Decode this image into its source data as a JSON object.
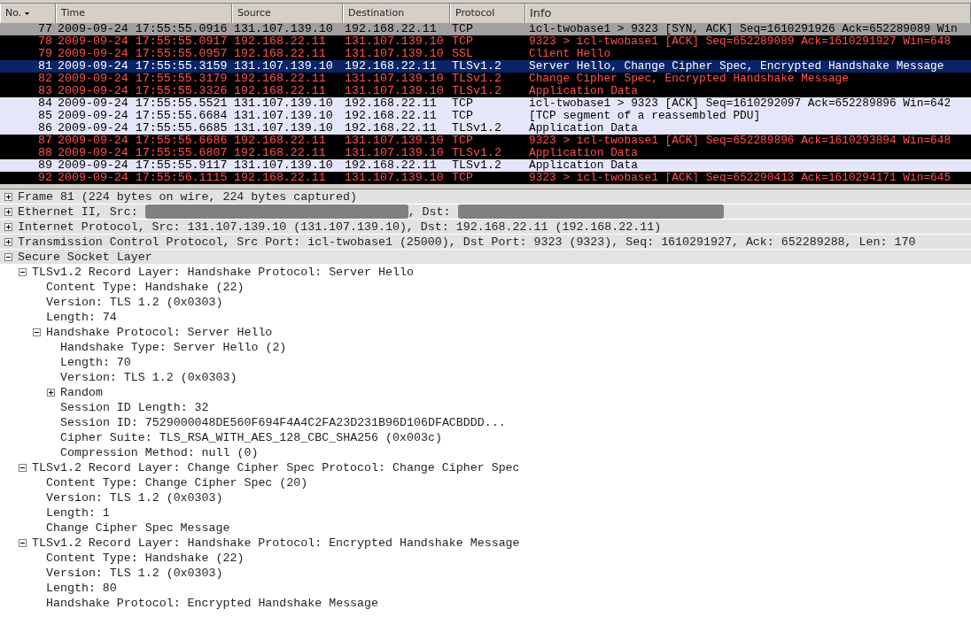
{
  "packet_list": {
    "columns": [
      {
        "label": "No.",
        "sorted": true
      },
      {
        "label": "Time",
        "sorted": false
      },
      {
        "label": "Source",
        "sorted": false
      },
      {
        "label": "Destination",
        "sorted": false
      },
      {
        "label": "Protocol",
        "sorted": false
      },
      {
        "label": "Info",
        "sorted": false
      }
    ],
    "rows": [
      {
        "no": "77",
        "time": "2009-09-24 17:55:55.0916",
        "source": "131.107.139.10",
        "destination": "192.168.22.11",
        "protocol": "TCP",
        "info": "icl-twobase1 > 9323 [SYN, ACK] Seq=1610291926 Ack=652289089 Win",
        "kind": "muted",
        "selected": false
      },
      {
        "no": "78",
        "time": "2009-09-24 17:55:55.0917",
        "source": "192.168.22.11",
        "destination": "131.107.139.10",
        "protocol": "TCP",
        "info": "9323 > icl-twobase1 [ACK] Seq=652289089 Ack=1610291927 Win=648",
        "kind": "alert",
        "selected": false
      },
      {
        "no": "79",
        "time": "2009-09-24 17:55:55.0957",
        "source": "192.168.22.11",
        "destination": "131.107.139.10",
        "protocol": "SSL",
        "info": "Client Hello",
        "kind": "alert",
        "selected": false
      },
      {
        "no": "81",
        "time": "2009-09-24 17:55:55.3159",
        "source": "131.107.139.10",
        "destination": "192.168.22.11",
        "protocol": "TLSv1.2",
        "info": "Server Hello, Change Cipher Spec, Encrypted Handshake Message",
        "kind": "normal",
        "selected": true
      },
      {
        "no": "82",
        "time": "2009-09-24 17:55:55.3179",
        "source": "192.168.22.11",
        "destination": "131.107.139.10",
        "protocol": "TLSv1.2",
        "info": "Change Cipher Spec, Encrypted Handshake Message",
        "kind": "alert",
        "selected": false
      },
      {
        "no": "83",
        "time": "2009-09-24 17:55:55.3326",
        "source": "192.168.22.11",
        "destination": "131.107.139.10",
        "protocol": "TLSv1.2",
        "info": "Application Data",
        "kind": "alert",
        "selected": false
      },
      {
        "no": "84",
        "time": "2009-09-24 17:55:55.5521",
        "source": "131.107.139.10",
        "destination": "192.168.22.11",
        "protocol": "TCP",
        "info": "icl-twobase1 > 9323 [ACK] Seq=1610292097 Ack=652289896 Win=642",
        "kind": "normal",
        "selected": false
      },
      {
        "no": "85",
        "time": "2009-09-24 17:55:55.6684",
        "source": "131.107.139.10",
        "destination": "192.168.22.11",
        "protocol": "TCP",
        "info": "[TCP segment of a reassembled PDU]",
        "kind": "normal",
        "selected": false
      },
      {
        "no": "86",
        "time": "2009-09-24 17:55:55.6685",
        "source": "131.107.139.10",
        "destination": "192.168.22.11",
        "protocol": "TLSv1.2",
        "info": "Application Data",
        "kind": "normal",
        "selected": false
      },
      {
        "no": "87",
        "time": "2009-09-24 17:55:55.6686",
        "source": "192.168.22.11",
        "destination": "131.107.139.10",
        "protocol": "TCP",
        "info": "9323 > icl-twobase1 [ACK] Seq=652289896 Ack=1610293894 Win=648",
        "kind": "alert",
        "selected": false
      },
      {
        "no": "88",
        "time": "2009-09-24 17:55:55.6807",
        "source": "192.168.22.11",
        "destination": "131.107.139.10",
        "protocol": "TLSv1.2",
        "info": "Application Data",
        "kind": "alert",
        "selected": false
      },
      {
        "no": "89",
        "time": "2009-09-24 17:55:55.9117",
        "source": "131.107.139.10",
        "destination": "192.168.22.11",
        "protocol": "TLSv1.2",
        "info": "Application Data",
        "kind": "normal",
        "selected": false
      },
      {
        "no": "92",
        "time": "2009-09-24 17:55:56.1115",
        "source": "192.168.22.11",
        "destination": "131.107.139.10",
        "protocol": "TCP",
        "info": "9323 > icl-twobase1 [ACK] Seq=652290413 Ack=1610294171 Win=645",
        "kind": "alert",
        "selected": false
      }
    ]
  },
  "packet_details": [
    {
      "label": "Frame 81 (224 bytes on wire, 224 bytes captured)",
      "expanded": false
    },
    {
      "parts": [
        {
          "kind": "text",
          "text": "Ethernet II, Src: "
        },
        {
          "kind": "redacted"
        },
        {
          "kind": "text",
          "text": ", Dst: "
        },
        {
          "kind": "redacted"
        }
      ],
      "expanded": false
    },
    {
      "label": "Internet Protocol, Src: 131.107.139.10 (131.107.139.10), Dst: 192.168.22.11 (192.168.22.11)",
      "expanded": false
    },
    {
      "label": "Transmission Control Protocol, Src Port: icl-twobase1 (25000), Dst Port: 9323 (9323), Seq: 1610291927, Ack: 652289288, Len: 170",
      "expanded": false
    },
    {
      "label": "Secure Socket Layer",
      "expanded": true,
      "children": [
        {
          "label": "TLSv1.2 Record Layer: Handshake Protocol: Server Hello",
          "expanded": true,
          "children": [
            {
              "label": "Content Type: Handshake (22)"
            },
            {
              "label": "Version: TLS 1.2 (0x0303)"
            },
            {
              "label": "Length: 74"
            },
            {
              "label": "Handshake Protocol: Server Hello",
              "expanded": true,
              "children": [
                {
                  "label": "Handshake Type: Server Hello (2)"
                },
                {
                  "label": "Length: 70"
                },
                {
                  "label": "Version: TLS 1.2 (0x0303)"
                },
                {
                  "label": "Random",
                  "expanded": false
                },
                {
                  "label": "Session ID Length: 32"
                },
                {
                  "label": "Session ID: 7529000048DE560F694F4A4C2FA23D231B96D106DFACBDDD..."
                },
                {
                  "label": "Cipher Suite: TLS_RSA_WITH_AES_128_CBC_SHA256 (0x003c)"
                },
                {
                  "label": "Compression Method: null (0)"
                }
              ]
            }
          ]
        },
        {
          "label": "TLSv1.2 Record Layer: Change Cipher Spec Protocol: Change Cipher Spec",
          "expanded": true,
          "children": [
            {
              "label": "Content Type: Change Cipher Spec (20)"
            },
            {
              "label": "Version: TLS 1.2 (0x0303)"
            },
            {
              "label": "Length: 1"
            },
            {
              "label": "Change Cipher Spec Message"
            }
          ]
        },
        {
          "label": "TLSv1.2 Record Layer: Handshake Protocol: Encrypted Handshake Message",
          "expanded": true,
          "children": [
            {
              "label": "Content Type: Handshake (22)"
            },
            {
              "label": "Version: TLS 1.2 (0x0303)"
            },
            {
              "label": "Length: 80"
            },
            {
              "label": "Handshake Protocol: Encrypted Handshake Message"
            }
          ]
        }
      ]
    }
  ]
}
